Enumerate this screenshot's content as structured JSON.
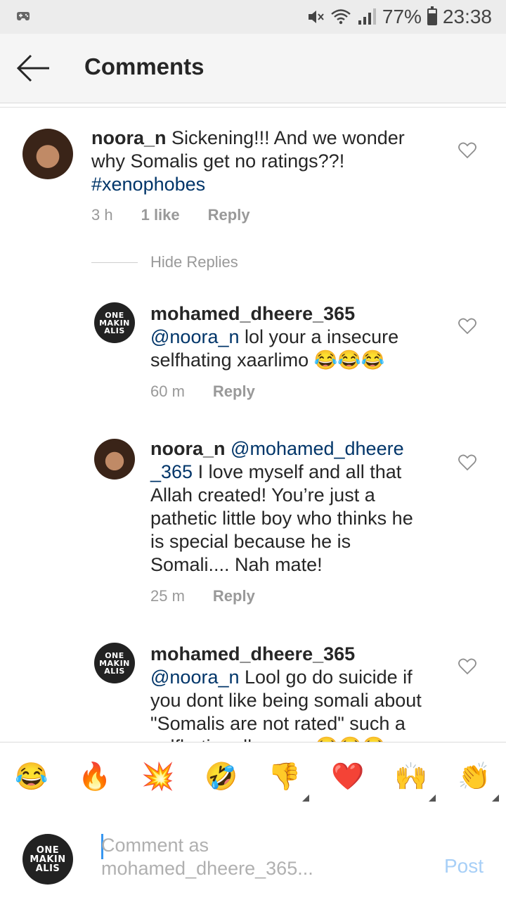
{
  "status_bar": {
    "battery": "77%",
    "time": "23:38",
    "signal_icons": [
      "game-controller-icon",
      "mute-icon",
      "wifi-icon",
      "signal-icon",
      "battery-icon"
    ]
  },
  "header": {
    "title": "Comments"
  },
  "comments": [
    {
      "username": "noora_n",
      "text": "Sickening!!! And we wonder why Somalis get no ratings??!",
      "hashtag": "#xenophobes",
      "time": "3 h",
      "likes": "1 like",
      "reply": "Reply"
    }
  ],
  "hide_replies": "Hide Replies",
  "replies": [
    {
      "username": "mohamed_dheere_365",
      "mention": "@noora_n",
      "text": " lol your a insecure selfhating xaarlimo 😂😂😂",
      "time": "60 m",
      "reply": "Reply"
    },
    {
      "username": "noora_n",
      "mention": "@mohamed_dheere _365",
      "text": " I love myself and all that Allah created! You’re just a pathetic little boy who thinks he is special because he is Somali.... Nah mate!",
      "time": "25 m",
      "reply": "Reply"
    },
    {
      "username": "mohamed_dheere_365",
      "mention": "@noora_n",
      "text": "  Lool go do suicide if you dont like being somali about \"Somalis are not rated\" such a selfhating dhagaxa 😂😂😂",
      "time": "",
      "reply": ""
    }
  ],
  "avatar_logo_text": "ONE MAKIN ALIS",
  "emoji_bar": [
    "😂",
    "🔥",
    "💥",
    "🤣",
    "👎",
    "❤️",
    "🙌",
    "👏"
  ],
  "composer": {
    "placeholder": "Comment as mohamed_dheere_365...",
    "post": "Post"
  },
  "colors": {
    "mention": "#003569",
    "post_disabled": "#a7cff7",
    "caret": "#3897f0"
  }
}
